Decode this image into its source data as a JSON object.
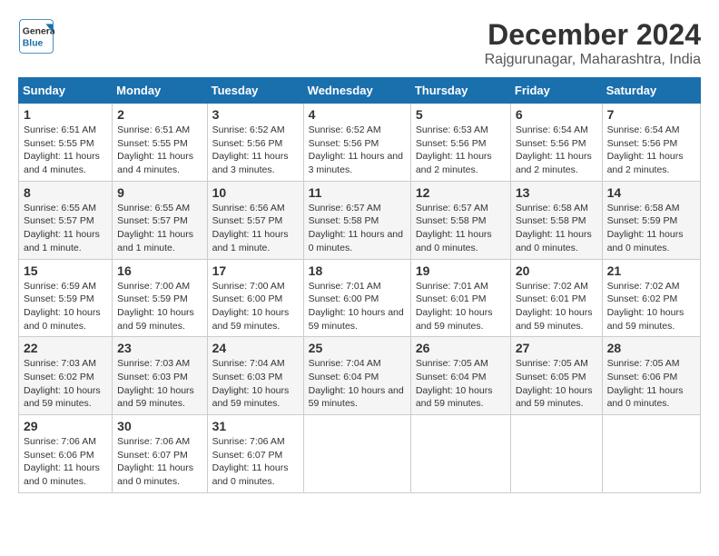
{
  "logo": {
    "line1": "General",
    "line2": "Blue"
  },
  "title": "December 2024",
  "subtitle": "Rajgurunagar, Maharashtra, India",
  "headers": [
    "Sunday",
    "Monday",
    "Tuesday",
    "Wednesday",
    "Thursday",
    "Friday",
    "Saturday"
  ],
  "weeks": [
    [
      {
        "day": "1",
        "sunrise": "6:51 AM",
        "sunset": "5:55 PM",
        "daylight": "11 hours and 4 minutes."
      },
      {
        "day": "2",
        "sunrise": "6:51 AM",
        "sunset": "5:55 PM",
        "daylight": "11 hours and 4 minutes."
      },
      {
        "day": "3",
        "sunrise": "6:52 AM",
        "sunset": "5:56 PM",
        "daylight": "11 hours and 3 minutes."
      },
      {
        "day": "4",
        "sunrise": "6:52 AM",
        "sunset": "5:56 PM",
        "daylight": "11 hours and 3 minutes."
      },
      {
        "day": "5",
        "sunrise": "6:53 AM",
        "sunset": "5:56 PM",
        "daylight": "11 hours and 2 minutes."
      },
      {
        "day": "6",
        "sunrise": "6:54 AM",
        "sunset": "5:56 PM",
        "daylight": "11 hours and 2 minutes."
      },
      {
        "day": "7",
        "sunrise": "6:54 AM",
        "sunset": "5:56 PM",
        "daylight": "11 hours and 2 minutes."
      }
    ],
    [
      {
        "day": "8",
        "sunrise": "6:55 AM",
        "sunset": "5:57 PM",
        "daylight": "11 hours and 1 minute."
      },
      {
        "day": "9",
        "sunrise": "6:55 AM",
        "sunset": "5:57 PM",
        "daylight": "11 hours and 1 minute."
      },
      {
        "day": "10",
        "sunrise": "6:56 AM",
        "sunset": "5:57 PM",
        "daylight": "11 hours and 1 minute."
      },
      {
        "day": "11",
        "sunrise": "6:57 AM",
        "sunset": "5:58 PM",
        "daylight": "11 hours and 0 minutes."
      },
      {
        "day": "12",
        "sunrise": "6:57 AM",
        "sunset": "5:58 PM",
        "daylight": "11 hours and 0 minutes."
      },
      {
        "day": "13",
        "sunrise": "6:58 AM",
        "sunset": "5:58 PM",
        "daylight": "11 hours and 0 minutes."
      },
      {
        "day": "14",
        "sunrise": "6:58 AM",
        "sunset": "5:59 PM",
        "daylight": "11 hours and 0 minutes."
      }
    ],
    [
      {
        "day": "15",
        "sunrise": "6:59 AM",
        "sunset": "5:59 PM",
        "daylight": "10 hours and 0 minutes."
      },
      {
        "day": "16",
        "sunrise": "7:00 AM",
        "sunset": "5:59 PM",
        "daylight": "10 hours and 59 minutes."
      },
      {
        "day": "17",
        "sunrise": "7:00 AM",
        "sunset": "6:00 PM",
        "daylight": "10 hours and 59 minutes."
      },
      {
        "day": "18",
        "sunrise": "7:01 AM",
        "sunset": "6:00 PM",
        "daylight": "10 hours and 59 minutes."
      },
      {
        "day": "19",
        "sunrise": "7:01 AM",
        "sunset": "6:01 PM",
        "daylight": "10 hours and 59 minutes."
      },
      {
        "day": "20",
        "sunrise": "7:02 AM",
        "sunset": "6:01 PM",
        "daylight": "10 hours and 59 minutes."
      },
      {
        "day": "21",
        "sunrise": "7:02 AM",
        "sunset": "6:02 PM",
        "daylight": "10 hours and 59 minutes."
      }
    ],
    [
      {
        "day": "22",
        "sunrise": "7:03 AM",
        "sunset": "6:02 PM",
        "daylight": "10 hours and 59 minutes."
      },
      {
        "day": "23",
        "sunrise": "7:03 AM",
        "sunset": "6:03 PM",
        "daylight": "10 hours and 59 minutes."
      },
      {
        "day": "24",
        "sunrise": "7:04 AM",
        "sunset": "6:03 PM",
        "daylight": "10 hours and 59 minutes."
      },
      {
        "day": "25",
        "sunrise": "7:04 AM",
        "sunset": "6:04 PM",
        "daylight": "10 hours and 59 minutes."
      },
      {
        "day": "26",
        "sunrise": "7:05 AM",
        "sunset": "6:04 PM",
        "daylight": "10 hours and 59 minutes."
      },
      {
        "day": "27",
        "sunrise": "7:05 AM",
        "sunset": "6:05 PM",
        "daylight": "10 hours and 59 minutes."
      },
      {
        "day": "28",
        "sunrise": "7:05 AM",
        "sunset": "6:06 PM",
        "daylight": "11 hours and 0 minutes."
      }
    ],
    [
      {
        "day": "29",
        "sunrise": "7:06 AM",
        "sunset": "6:06 PM",
        "daylight": "11 hours and 0 minutes."
      },
      {
        "day": "30",
        "sunrise": "7:06 AM",
        "sunset": "6:07 PM",
        "daylight": "11 hours and 0 minutes."
      },
      {
        "day": "31",
        "sunrise": "7:06 AM",
        "sunset": "6:07 PM",
        "daylight": "11 hours and 0 minutes."
      },
      null,
      null,
      null,
      null
    ]
  ],
  "sunrise_label": "Sunrise:",
  "sunset_label": "Sunset:",
  "daylight_label": "Daylight:"
}
